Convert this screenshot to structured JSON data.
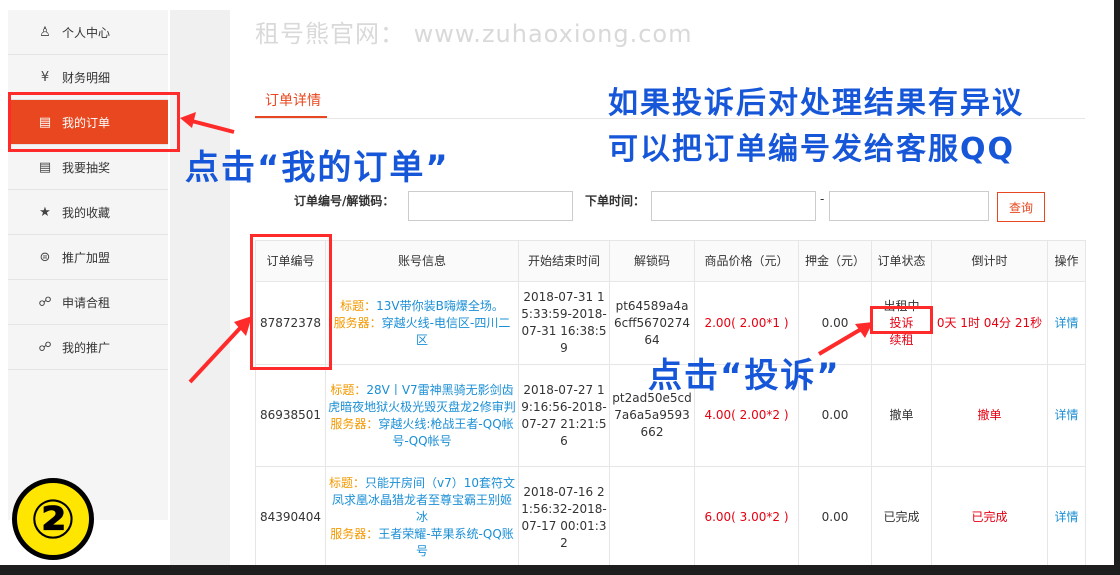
{
  "watermark": "租号熊官网： www.zuhaoxiong.com",
  "sidebar": {
    "items": [
      {
        "icon": "user-icon",
        "glyph": "♙",
        "label": "个人中心"
      },
      {
        "icon": "yen-icon",
        "glyph": "¥",
        "label": "财务明细"
      },
      {
        "icon": "document-icon",
        "glyph": "▤",
        "label": "我的订单"
      },
      {
        "icon": "document-icon",
        "glyph": "▤",
        "label": "我要抽奖"
      },
      {
        "icon": "star-icon",
        "glyph": "★",
        "label": "我的收藏"
      },
      {
        "icon": "share-icon",
        "glyph": "⊜",
        "label": "推广加盟"
      },
      {
        "icon": "group-icon",
        "glyph": "☍",
        "label": "申请合租"
      },
      {
        "icon": "group-icon",
        "glyph": "☍",
        "label": "我的推广"
      }
    ]
  },
  "tab": "订单详情",
  "filter": {
    "order_label": "订单编号/解锁码：",
    "time_label": "下单时间：",
    "dash": "-",
    "query": "查询"
  },
  "table": {
    "headers": [
      "订单编号",
      "账号信息",
      "开始结束时间",
      "解锁码",
      "商品价格（元）",
      "押金（元）",
      "订单状态",
      "倒计时",
      "操作"
    ],
    "rows": [
      {
        "id": "87872378",
        "title_label": "标题：",
        "title": "13V带你装B嗨爆全场。",
        "server_label": "服务器：",
        "server": "穿越火线-电信区-四川二区",
        "time": "2018-07-31 15:33:59-2018-07-31 16:38:59",
        "code": "pt64589a4a6cff567027464",
        "price": "2.00( 2.00*1 )",
        "deposit": "0.00",
        "status": "出租中",
        "complain": "投诉",
        "renew": "续租",
        "countdown": "0天 1时 04分 21秒",
        "action": "详情"
      },
      {
        "id": "86938501",
        "title_label": "标题：",
        "title": "28V丨V7雷神黑骑无影剑齿虎暗夜地狱火极光毁灭盘龙2修审判",
        "server_label": "服务器：",
        "server": "穿越火线:枪战王者-QQ帐号-QQ帐号",
        "time": "2018-07-27 19:16:56-2018-07-27 21:21:56",
        "code": "pt2ad50e5cd7a6a5a9593662",
        "price": "4.00( 2.00*2 )",
        "deposit": "0.00",
        "status": "撤单",
        "countdown": "撤单",
        "action": "详情"
      },
      {
        "id": "84390404",
        "title_label": "标题：",
        "title": "只能开房间（v7）10套符文凤求凰冰晶猎龙者至尊宝霸王别姬冰",
        "server_label": "服务器：",
        "server": "王者荣耀-苹果系统-QQ账号",
        "time": "2018-07-16 21:56:32-2018-07-17 00:01:32",
        "code": "",
        "price": "6.00( 3.00*2 )",
        "deposit": "0.00",
        "status": "已完成",
        "countdown": "已完成",
        "action": "详情"
      }
    ]
  },
  "annotations": {
    "click_orders": "点击“我的订单”",
    "dispute_line1": "如果投诉后对处理结果有异议",
    "dispute_line2": "可以把订单编号发给客服QQ",
    "click_complain": "点击“投诉”",
    "step": "②"
  },
  "colors": {
    "accent": "#e8471f",
    "annotation": "#1656d8",
    "highlight": "#ff2a2a",
    "link": "#1b8fd6"
  }
}
